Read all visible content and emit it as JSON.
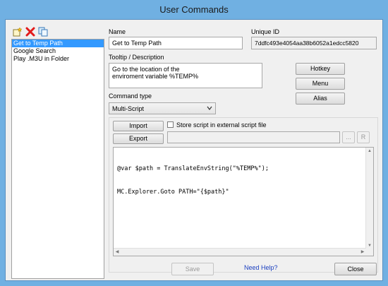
{
  "window": {
    "title": "User Commands"
  },
  "toolbar": {
    "new_icon": "new-command-icon",
    "delete_icon": "delete-icon",
    "copy_icon": "copy-icon",
    "delete_color": "#e21b1b"
  },
  "commands": {
    "items": [
      {
        "label": "Get to Temp Path",
        "selected": true
      },
      {
        "label": "Google Search",
        "selected": false
      },
      {
        "label": "Play .M3U in Folder",
        "selected": false
      }
    ]
  },
  "name": {
    "label": "Name",
    "value": "Get to Temp Path"
  },
  "unique_id": {
    "label": "Unique ID",
    "value": "7ddfc493e4054aa38b6052a1edcc5820"
  },
  "tooltip": {
    "label": "Tooltip / Description",
    "line1": "Go to the location of the",
    "line2": "enviroment variable %TEMP%"
  },
  "side_buttons": {
    "hotkey": "Hotkey",
    "menu": "Menu",
    "alias": "Alias"
  },
  "command_type": {
    "label": "Command type",
    "value": "Multi-Script"
  },
  "script": {
    "import_label": "Import",
    "export_label": "Export",
    "store_external_label": "Store script in external script file",
    "store_external_checked": false,
    "browse_label": "...",
    "reload_label": "R",
    "code_line1": "@var $path = TranslateEnvString(\"%TEMP%\");",
    "code_line2": "MC.Explorer.Goto PATH=\"{$path}\""
  },
  "footer": {
    "save_label": "Save",
    "help_label": "Need Help?",
    "close_label": "Close"
  },
  "colors": {
    "selection": "#3399ff",
    "link": "#1a3fc0",
    "frame": "#70b0e2"
  }
}
